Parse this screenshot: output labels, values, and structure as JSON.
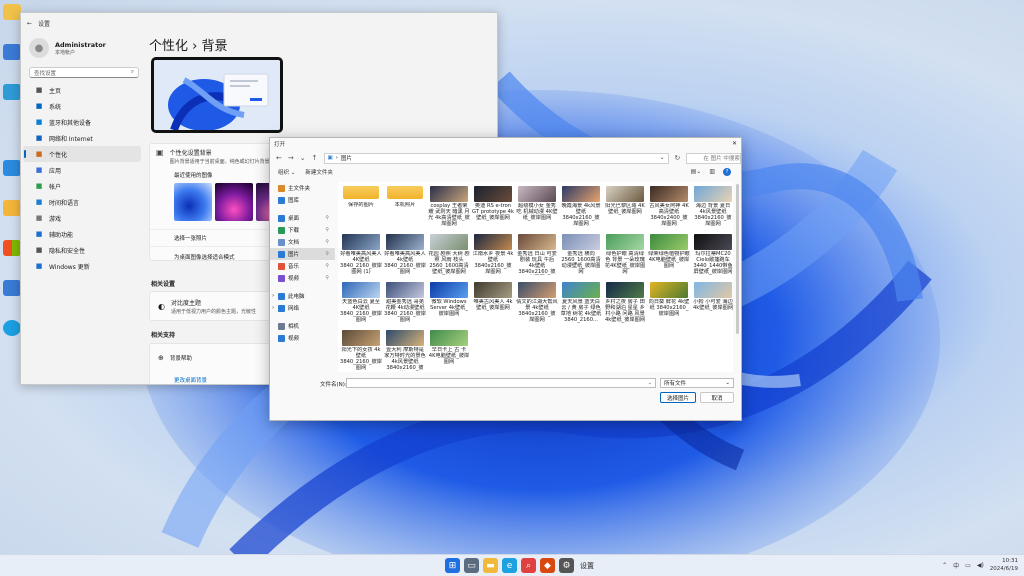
{
  "settings": {
    "title": "设置",
    "user": {
      "name": "Administrator",
      "sub": "本地帐户"
    },
    "search_placeholder": "查找设置",
    "nav": [
      {
        "label": "主页",
        "icon": "home-icon",
        "color": "#555"
      },
      {
        "label": "系统",
        "icon": "monitor-icon",
        "color": "#0067c0"
      },
      {
        "label": "蓝牙和其他设备",
        "icon": "bluetooth-icon",
        "color": "#0a7fd6"
      },
      {
        "label": "网络和 Internet",
        "icon": "wifi-icon",
        "color": "#1565c0"
      },
      {
        "label": "个性化",
        "icon": "brush-icon",
        "color": "#c96a1f"
      },
      {
        "label": "应用",
        "icon": "apps-icon",
        "color": "#3d6fd8"
      },
      {
        "label": "帐户",
        "icon": "account-icon",
        "color": "#2e9e4b"
      },
      {
        "label": "时间和语言",
        "icon": "globe-clock-icon",
        "color": "#1d7fd1"
      },
      {
        "label": "游戏",
        "icon": "gamepad-icon",
        "color": "#777"
      },
      {
        "label": "辅助功能",
        "icon": "accessibility-icon",
        "color": "#1d6fd1"
      },
      {
        "label": "隐私和安全性",
        "icon": "shield-icon",
        "color": "#555"
      },
      {
        "label": "Windows 更新",
        "icon": "update-icon",
        "color": "#1d6fd1"
      }
    ],
    "breadcrumb_parent": "个性化",
    "breadcrumb_sep": "›",
    "breadcrumb_current": "背景",
    "bg_card_title": "个性化设置背景",
    "bg_card_sub": "图片背景适用于当前桌面。纯色或幻灯片背景适用于所有桌面。",
    "recent_label": "最近使用的图像",
    "choose_photo": "选择一张照片",
    "fit_label": "为桌面图像选择适合模式",
    "related_label": "相关设置",
    "contrast_title": "对比度主题",
    "contrast_sub": "适用于低视力用户的颜色主题，光敏性",
    "support_label": "相关支持",
    "help_label": "背景帮助",
    "change_bg": "更改桌面背景"
  },
  "dialog": {
    "title": "打开",
    "address": "图片",
    "search_placeholder": "在 图片 中搜索",
    "organize": "组织",
    "new_folder": "新建文件夹",
    "pane_items": [
      {
        "label": "主文件夹",
        "icon": "home-icon",
        "color": "#d98a2b",
        "pin": false
      },
      {
        "label": "图库",
        "icon": "gallery-icon",
        "color": "#2a7ad6",
        "pin": false
      },
      {
        "label": "桌面",
        "icon": "desktop-folder-icon",
        "color": "#2a7ad6",
        "pin": true
      },
      {
        "label": "下载",
        "icon": "download-icon",
        "color": "#2a9a5a",
        "pin": true
      },
      {
        "label": "文档",
        "icon": "document-icon",
        "color": "#6a8fc9",
        "pin": true
      },
      {
        "label": "图片",
        "icon": "pictures-icon",
        "color": "#2a7ad6",
        "pin": true,
        "active": true
      },
      {
        "label": "音乐",
        "icon": "music-icon",
        "color": "#e0533a",
        "pin": true
      },
      {
        "label": "视频",
        "icon": "video-icon",
        "color": "#7a4fd0",
        "pin": true
      },
      {
        "label": "此电脑",
        "icon": "pc-icon",
        "color": "#2a7ad6",
        "pin": false,
        "expand": true
      },
      {
        "label": "网络",
        "icon": "network-icon",
        "color": "#2a7ad6",
        "pin": false,
        "expand": true
      },
      {
        "label": "相机",
        "icon": "camera-folder-icon",
        "color": "#6c7a90",
        "pin": false
      },
      {
        "label": "视频",
        "icon": "video-icon",
        "color": "#2a7ad6",
        "pin": false
      }
    ],
    "files": [
      {
        "name": "保存的图片",
        "folder": true
      },
      {
        "name": "本机照片",
        "folder": true
      },
      {
        "name": "cosplay 王者荣耀 武则天 暗黑 月光 4k高清壁纸_彼岸图网",
        "c1": "#2a2f48",
        "c2": "#c9a57d"
      },
      {
        "name": "奥迪 RS e-tron GT prototype 4k壁纸_彼岸图网",
        "c1": "#1c2230",
        "c2": "#6a4c3a"
      },
      {
        "name": "超级模小女 金秀 吃 机械动漫 4K壁纸_彼岸图网",
        "c1": "#c8b8c2",
        "c2": "#5b4a52"
      },
      {
        "name": "晚霞海景 4k风景壁纸 3840x2160_彼岸图网",
        "c1": "#2b3a66",
        "c2": "#e8a36e"
      },
      {
        "name": "阳光巴黎区域 4K壁纸_彼岸图网",
        "c1": "#d9d2c4",
        "c2": "#6c5a40"
      },
      {
        "name": "古风美女阿神 4K高清壁纸 3840x2400_彼岸图网",
        "c1": "#3a2a24",
        "c2": "#b58c6a"
      },
      {
        "name": "海边 背景 夏日 4k风景壁纸 3840x2160_彼岸图网",
        "c1": "#6fa6d8",
        "c2": "#e9d3b2"
      },
      {
        "name": "好看唯美高风美人 4K壁纸 3840_2160_彼岸图网 (1)",
        "c1": "#243452",
        "c2": "#8aa6c9"
      },
      {
        "name": "好看唯美高风美人 4k壁纸 3840_2160_彼岸图网",
        "c1": "#22304a",
        "c2": "#9bb2cf"
      },
      {
        "name": "花园 剧照 大树 剧照 风雨 枝头 2560_1600高清壁纸_彼岸图网",
        "c1": "#c9d0d9",
        "c2": "#7a8f6e"
      },
      {
        "name": "江南水乡 夜景 4k壁纸 3840x2160_彼岸图网",
        "c1": "#1b2640",
        "c2": "#c28a4e"
      },
      {
        "name": "金秀远 日山 可爱 剧装 玩具 午后 4k壁纸 3840x2160_彼岸图网",
        "c1": "#6a4a3a",
        "c2": "#d8b88e"
      },
      {
        "name": "金秀远 横向 2560_1600高清动漫壁纸_彼岸图网",
        "c1": "#7b8fb6",
        "c2": "#c9cde0"
      },
      {
        "name": "绿色护眼 高清绿色 背景 一朵玫瑰花4K壁纸_彼岸图网",
        "c1": "#4b9e5b",
        "c2": "#a6d6a5"
      },
      {
        "name": "绿荣绿色植物护眼4K电脑壁纸_彼岸图网",
        "c1": "#3c8a3f",
        "c2": "#9acb6a"
      },
      {
        "name": "玛尔拉蒂MC20 Cielo敞篷跑车 3440_1440带鱼屏壁纸_彼岸图网",
        "c1": "#101010",
        "c2": "#4a4a55"
      },
      {
        "name": "天蓝色白云 夏至 4K壁纸 3840_2160_彼岸图网",
        "c1": "#2d66b8",
        "c2": "#bcd6ef"
      },
      {
        "name": "甜美金秀远 哥弟 花鞭 4k动漫壁纸 3840_2160_彼岸图网",
        "c1": "#3c4e7a",
        "c2": "#c5c9df"
      },
      {
        "name": "微软 Windows Server 4k壁纸_彼岸图网",
        "c1": "#0b3aa8",
        "c2": "#5aa0f0"
      },
      {
        "name": "唯美古风美人 4k壁纸_彼岸图网",
        "c1": "#3f3a2e",
        "c2": "#a69d83"
      },
      {
        "name": "倩文的江湖大帮风景 4k壁纸 3840x2160_彼岸图网",
        "c1": "#3a4e6a",
        "c2": "#d59f70"
      },
      {
        "name": "夏天风景 蓝天白云 / 黄 房子 绿色草地 树花 4k壁纸 3840_2160...",
        "c1": "#3f83d0",
        "c2": "#6bb04a"
      },
      {
        "name": "乡村之夜 房子 田野和湖泊 星星 乡村小路 问路 风景4k壁纸_彼岸图网",
        "c1": "#152a4a",
        "c2": "#4f7b46"
      },
      {
        "name": "向日葵 鲜花 4k壁纸 3840x2160_彼岸图网",
        "c1": "#e3b525",
        "c2": "#4a7a2f"
      },
      {
        "name": "小狗 小可爱 海边 4k壁纸_彼岸图网",
        "c1": "#7fb7e6",
        "c2": "#e2c7a3"
      },
      {
        "name": "阳光下的女孩 4k壁纸 3840_2160_彼岸图网",
        "c1": "#5a4a3a",
        "c2": "#c9a272"
      },
      {
        "name": "壹大利 摩斯特是家万特时光的景色 4k风景壁纸 3840x2160_彼岸...",
        "c1": "#2a4a6a",
        "c2": "#d8b27a"
      },
      {
        "name": "早日卡上 古 卡 4K电脑壁纸_彼岸图网",
        "c1": "#3e8b4c",
        "c2": "#a8d07c"
      }
    ],
    "filename_label": "文件名(N):",
    "filename_value": "",
    "filetype": "所有文件",
    "open_btn": "选择图片",
    "cancel_btn": "取消"
  },
  "taskbar": {
    "app_label": "设置",
    "time": "10:31",
    "date": "2024/6/19"
  },
  "colors": {
    "accent": "#0067c0",
    "folder": "#f4c14a"
  }
}
